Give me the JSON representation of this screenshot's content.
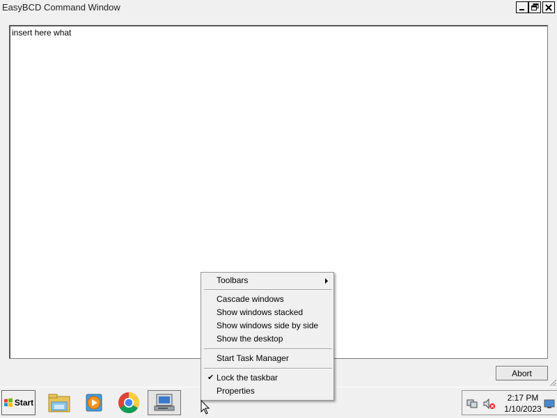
{
  "window": {
    "title": "EasyBCD Command Window",
    "output_text": "insert here what",
    "abort_label": "Abort"
  },
  "titlebar_buttons": [
    "minimize-icon",
    "restore-icon",
    "close-icon"
  ],
  "taskbar": {
    "start_label": "Start",
    "apps": [
      "file-explorer-icon",
      "media-player-icon",
      "chrome-icon",
      "easybcd-icon"
    ],
    "tray_icons": [
      "network-icon",
      "volume-muted-icon",
      "desktop-icon"
    ],
    "clock_time": "2:17 PM",
    "clock_date": "1/10/2023"
  },
  "context_menu": {
    "toolbars": "Toolbars",
    "cascade": "Cascade windows",
    "stacked": "Show windows stacked",
    "side_by_side": "Show windows side by side",
    "show_desktop": "Show the desktop",
    "task_manager": "Start Task Manager",
    "lock_taskbar": "Lock the taskbar",
    "lock_checked": true,
    "properties": "Properties"
  }
}
